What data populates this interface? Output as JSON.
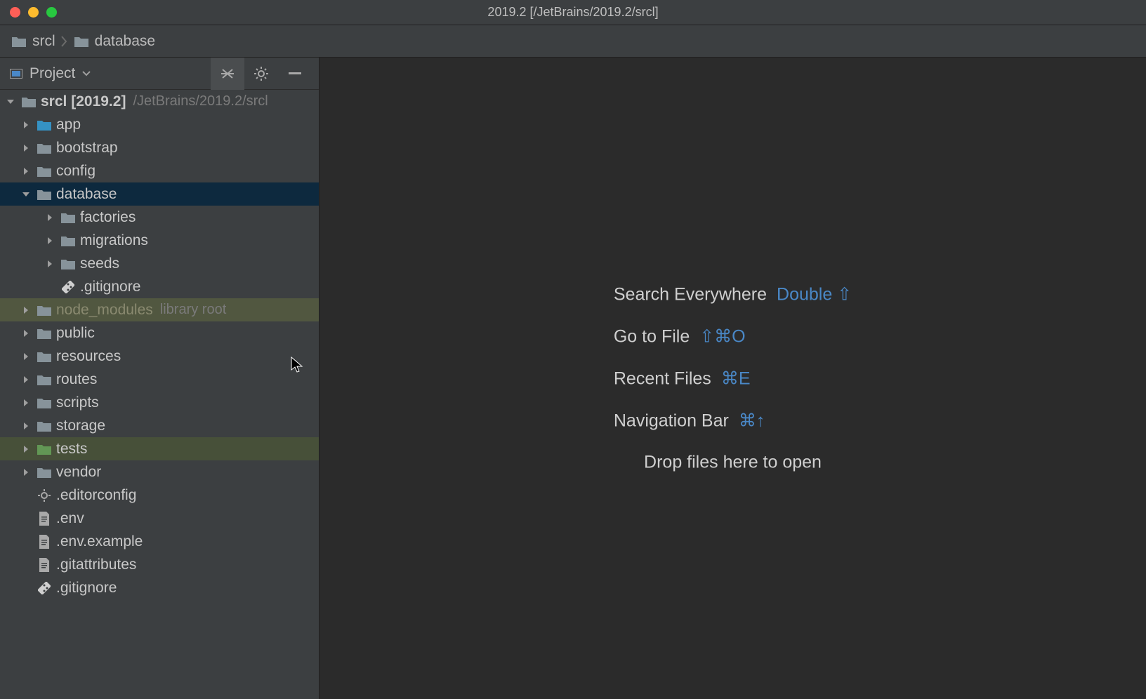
{
  "window": {
    "title": "2019.2 [/JetBrains/2019.2/srcl]"
  },
  "breadcrumb": [
    {
      "name": "srcl"
    },
    {
      "name": "database"
    }
  ],
  "sidebar": {
    "panel": "Project",
    "root": {
      "label": "srcl",
      "tag": "[2019.2]",
      "path": "/JetBrains/2019.2/srcl"
    },
    "items": [
      {
        "depth": 1,
        "kind": "folder",
        "icon": "blue",
        "label": "app",
        "expand": "right"
      },
      {
        "depth": 1,
        "kind": "folder",
        "icon": "grey",
        "label": "bootstrap",
        "expand": "right"
      },
      {
        "depth": 1,
        "kind": "folder",
        "icon": "grey",
        "label": "config",
        "expand": "right"
      },
      {
        "depth": 1,
        "kind": "folder",
        "icon": "grey",
        "label": "database",
        "expand": "down",
        "sel": true
      },
      {
        "depth": 2,
        "kind": "folder",
        "icon": "grey",
        "label": "factories",
        "expand": "right"
      },
      {
        "depth": 2,
        "kind": "folder",
        "icon": "grey",
        "label": "migrations",
        "expand": "right"
      },
      {
        "depth": 2,
        "kind": "folder",
        "icon": "grey",
        "label": "seeds",
        "expand": "right"
      },
      {
        "depth": 2,
        "kind": "file",
        "icon": "git",
        "label": ".gitignore"
      },
      {
        "depth": 1,
        "kind": "folder",
        "icon": "grey",
        "label": "node_modules",
        "suffix": "library root",
        "expand": "right",
        "lib": true
      },
      {
        "depth": 1,
        "kind": "folder",
        "icon": "grey",
        "label": "public",
        "expand": "right"
      },
      {
        "depth": 1,
        "kind": "folder",
        "icon": "grey",
        "label": "resources",
        "expand": "right"
      },
      {
        "depth": 1,
        "kind": "folder",
        "icon": "grey",
        "label": "routes",
        "expand": "right"
      },
      {
        "depth": 1,
        "kind": "folder",
        "icon": "grey",
        "label": "scripts",
        "expand": "right"
      },
      {
        "depth": 1,
        "kind": "folder",
        "icon": "grey",
        "label": "storage",
        "expand": "right"
      },
      {
        "depth": 1,
        "kind": "folder",
        "icon": "green",
        "label": "tests",
        "expand": "right",
        "tests": true
      },
      {
        "depth": 1,
        "kind": "folder",
        "icon": "grey",
        "label": "vendor",
        "expand": "right"
      },
      {
        "depth": 1,
        "kind": "file",
        "icon": "gear",
        "label": ".editorconfig"
      },
      {
        "depth": 1,
        "kind": "file",
        "icon": "text",
        "label": ".env"
      },
      {
        "depth": 1,
        "kind": "file",
        "icon": "text",
        "label": ".env.example"
      },
      {
        "depth": 1,
        "kind": "file",
        "icon": "text",
        "label": ".gitattributes"
      },
      {
        "depth": 1,
        "kind": "file",
        "icon": "git",
        "label": ".gitignore"
      }
    ]
  },
  "hints": [
    {
      "label": "Search Everywhere",
      "shortcut": "Double ⇧"
    },
    {
      "label": "Go to File",
      "shortcut": "⇧⌘O"
    },
    {
      "label": "Recent Files",
      "shortcut": "⌘E"
    },
    {
      "label": "Navigation Bar",
      "shortcut": "⌘↑"
    },
    {
      "label": "Drop files here to open",
      "shortcut": ""
    }
  ]
}
